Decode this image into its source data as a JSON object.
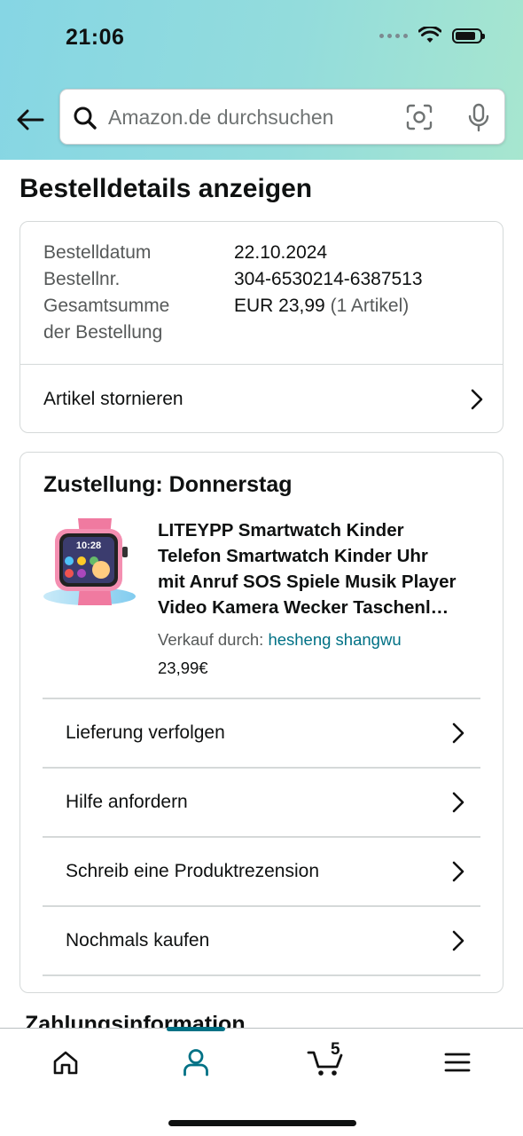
{
  "status_bar": {
    "time": "21:06"
  },
  "search": {
    "placeholder": "Amazon.de durchsuchen"
  },
  "page": {
    "title": "Bestelldetails anzeigen"
  },
  "order_summary": {
    "date_label": "Bestelldatum",
    "date_value": "22.10.2024",
    "number_label": "Bestellnr.",
    "number_value": "304-6530214-6387513",
    "total_label_line1": "Gesamtsumme",
    "total_label_line2": "der Bestellung",
    "total_value": "EUR 23,99",
    "total_items": "(1 Artikel)",
    "cancel_label": "Artikel stornieren"
  },
  "delivery": {
    "title": "Zustellung: Donnerstag",
    "product": {
      "title_lines": [
        "LITEYPP Smartwatch Kinder",
        "Telefon Smartwatch Kinder Uhr",
        "mit Anruf SOS Spiele Musik Player",
        "Video Kamera Wecker Taschenl…"
      ],
      "seller_prefix": "Verkauf durch: ",
      "seller_name": "hesheng shangwu",
      "price": "23,99€",
      "image_time": "10:28"
    },
    "actions": [
      "Lieferung verfolgen",
      "Hilfe anfordern",
      "Schreib eine Produktrezension",
      "Nochmals kaufen"
    ]
  },
  "next_section": {
    "title": "Zahlungsinformation"
  },
  "tabbar": {
    "cart_count": "5"
  },
  "colors": {
    "link": "#007185",
    "header_start": "#86d6e4",
    "header_end": "#a7e6cf"
  }
}
